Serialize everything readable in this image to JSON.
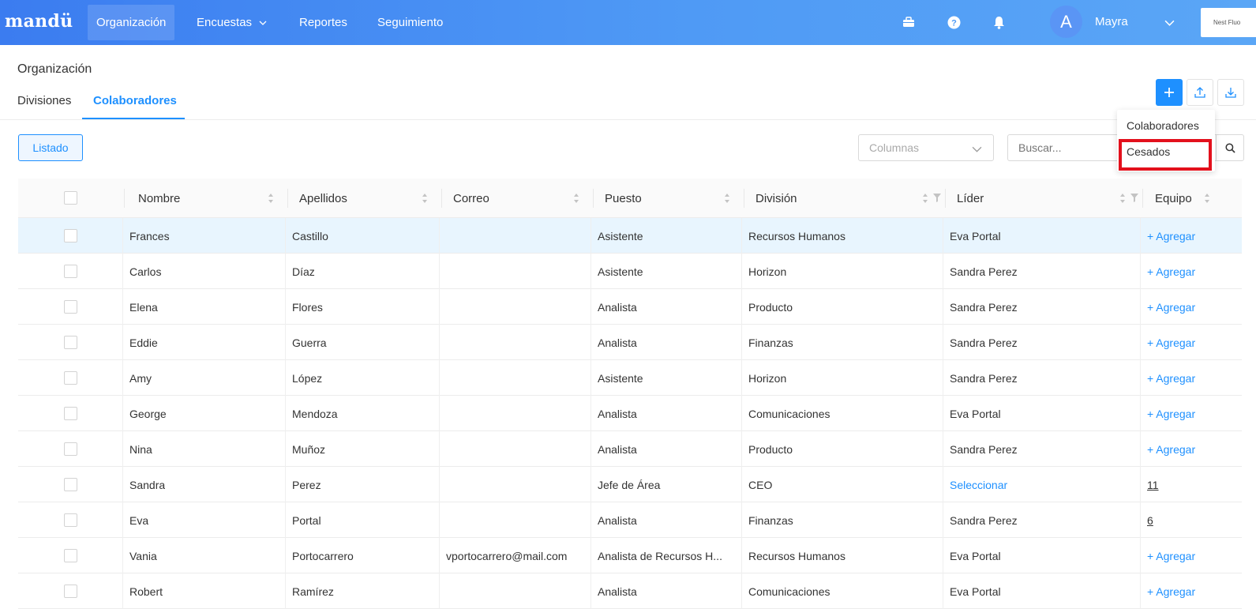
{
  "app": {
    "logo": "mandü",
    "nav": [
      {
        "label": "Organización",
        "active": true
      },
      {
        "label": "Encuestas",
        "has_dropdown": true
      },
      {
        "label": "Reportes"
      },
      {
        "label": "Seguimiento"
      }
    ],
    "icons": [
      "briefcase-icon",
      "help-icon",
      "bell-icon"
    ],
    "user": {
      "initial": "A",
      "name": "Mayra"
    },
    "brand_label": "Nest Fluo"
  },
  "page": {
    "title": "Organización",
    "tabs": [
      {
        "label": "Divisiones",
        "active": false
      },
      {
        "label": "Colaboradores",
        "active": true
      }
    ]
  },
  "actions": {
    "add_icon": "plus-icon",
    "upload_icon": "upload-icon",
    "download_icon": "download-icon",
    "menu": [
      "Colaboradores",
      "Cesados"
    ],
    "highlighted_item": "Cesados"
  },
  "toolbar": {
    "view_button": "Listado",
    "columns_placeholder": "Columnas",
    "search_placeholder": "Buscar..."
  },
  "table": {
    "columns": [
      "Nombre",
      "Apellidos",
      "Correo",
      "Puesto",
      "División",
      "Líder",
      "Equipo"
    ],
    "rows": [
      {
        "nombre": "Frances",
        "apellidos": "Castillo",
        "correo": "",
        "puesto": "Asistente",
        "division": "Recursos Humanos",
        "lider": "Eva Portal",
        "equipo": "+ Agregar"
      },
      {
        "nombre": "Carlos",
        "apellidos": "Díaz",
        "correo": "",
        "puesto": "Asistente",
        "division": "Horizon",
        "lider": "Sandra Perez",
        "equipo": "+ Agregar"
      },
      {
        "nombre": "Elena",
        "apellidos": "Flores",
        "correo": "",
        "puesto": "Analista",
        "division": "Producto",
        "lider": "Sandra Perez",
        "equipo": "+ Agregar"
      },
      {
        "nombre": "Eddie",
        "apellidos": "Guerra",
        "correo": "",
        "puesto": "Analista",
        "division": "Finanzas",
        "lider": "Sandra Perez",
        "equipo": "+ Agregar"
      },
      {
        "nombre": "Amy",
        "apellidos": "López",
        "correo": "",
        "puesto": "Asistente",
        "division": "Horizon",
        "lider": "Sandra Perez",
        "equipo": "+ Agregar"
      },
      {
        "nombre": "George",
        "apellidos": "Mendoza",
        "correo": "",
        "puesto": "Analista",
        "division": "Comunicaciones",
        "lider": "Eva Portal",
        "equipo": "+ Agregar"
      },
      {
        "nombre": "Nina",
        "apellidos": "Muñoz",
        "correo": "",
        "puesto": "Analista",
        "division": "Producto",
        "lider": "Sandra Perez",
        "equipo": "+ Agregar"
      },
      {
        "nombre": "Sandra",
        "apellidos": "Perez",
        "correo": "",
        "puesto": "Jefe de Área",
        "division": "CEO",
        "lider": "Seleccionar",
        "equipo": "11"
      },
      {
        "nombre": "Eva",
        "apellidos": "Portal",
        "correo": "",
        "puesto": "Analista",
        "division": "Finanzas",
        "lider": "Sandra Perez",
        "equipo": "6"
      },
      {
        "nombre": "Vania",
        "apellidos": "Portocarrero",
        "correo": "vportocarrero@mail.com",
        "puesto": "Analista de Recursos H...",
        "division": "Recursos Humanos",
        "lider": "Eva Portal",
        "equipo": "+ Agregar"
      },
      {
        "nombre": "Robert",
        "apellidos": "Ramírez",
        "correo": "",
        "puesto": "Analista",
        "division": "Comunicaciones",
        "lider": "Eva Portal",
        "equipo": "+ Agregar"
      }
    ]
  },
  "colors": {
    "accent": "#1e90ff",
    "topbar_start": "#3b7cf0",
    "topbar_end": "#5aa6f6",
    "highlight": "#e3101c",
    "selected_row": "#e8f5fe"
  }
}
